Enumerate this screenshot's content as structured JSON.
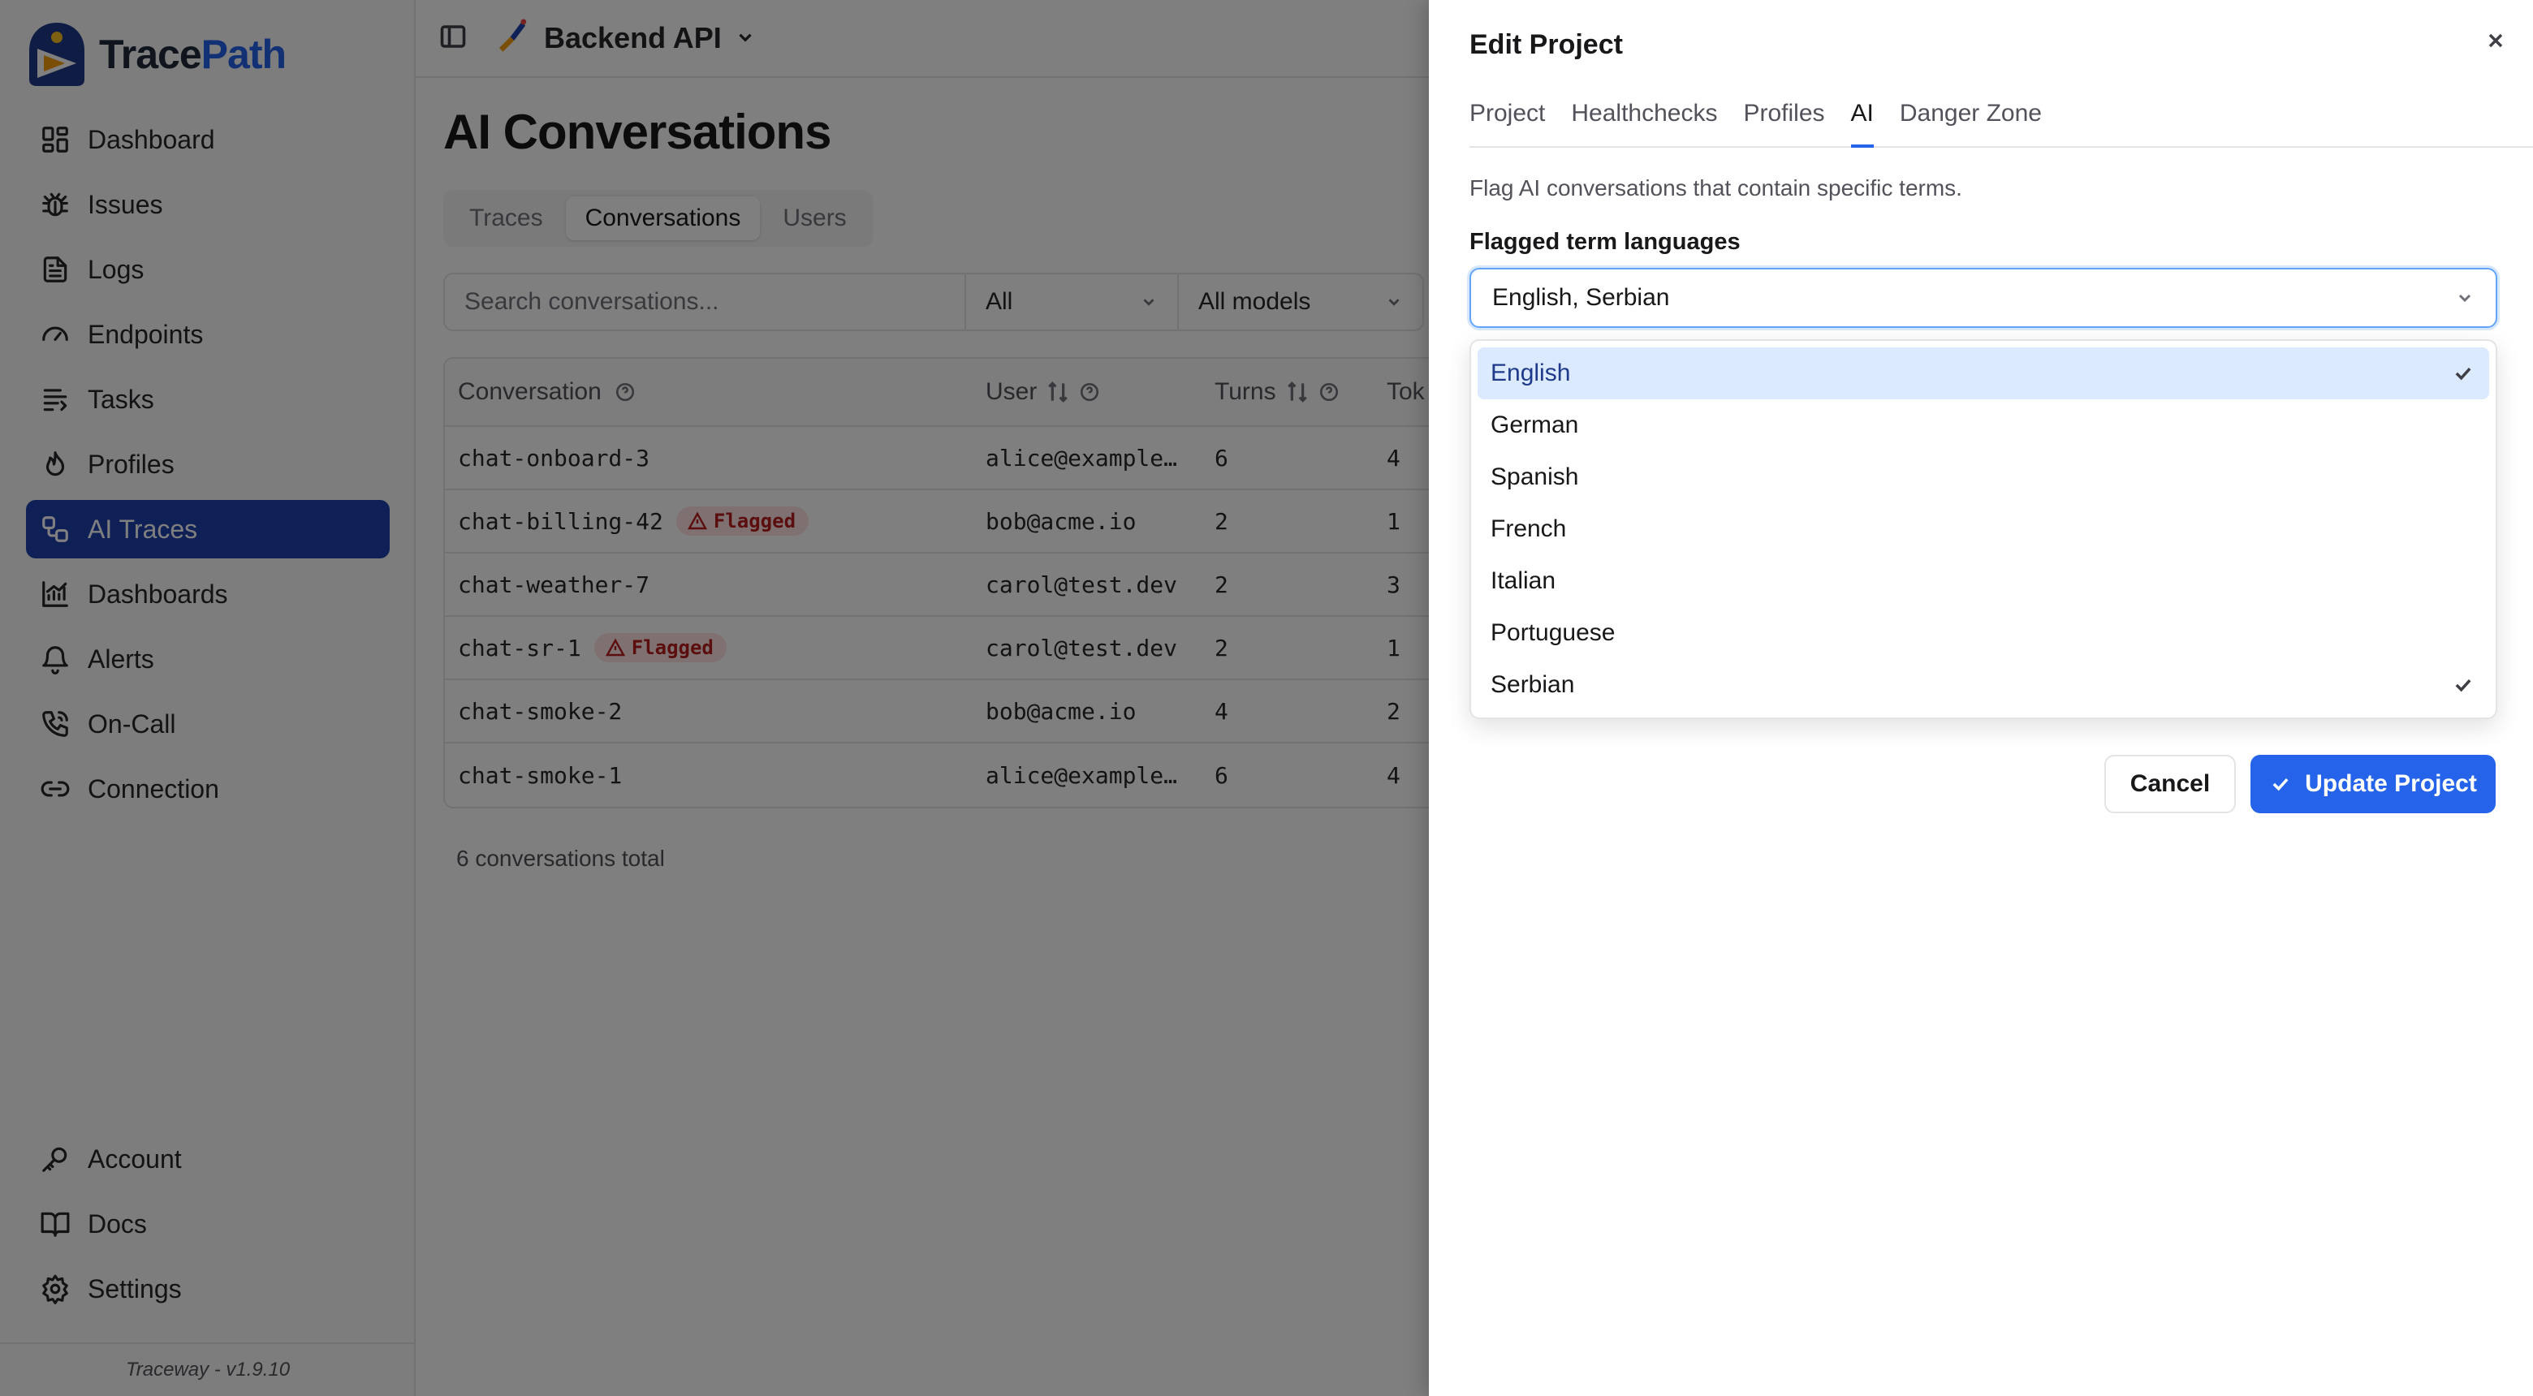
{
  "brand": {
    "name_a": "Trace",
    "name_b": "Path"
  },
  "sidebar": {
    "items": [
      {
        "label": "Dashboard",
        "icon": "dashboard-icon"
      },
      {
        "label": "Issues",
        "icon": "bug-icon"
      },
      {
        "label": "Logs",
        "icon": "file-text-icon"
      },
      {
        "label": "Endpoints",
        "icon": "gauge-icon"
      },
      {
        "label": "Tasks",
        "icon": "list-icon"
      },
      {
        "label": "Profiles",
        "icon": "flame-icon"
      },
      {
        "label": "AI Traces",
        "icon": "workflow-icon",
        "active": true
      },
      {
        "label": "Dashboards",
        "icon": "chart-icon"
      },
      {
        "label": "Alerts",
        "icon": "bell-icon"
      },
      {
        "label": "On-Call",
        "icon": "phone-icon"
      },
      {
        "label": "Connection",
        "icon": "link-icon"
      }
    ],
    "bottom_items": [
      {
        "label": "Account",
        "icon": "key-icon"
      },
      {
        "label": "Docs",
        "icon": "book-icon"
      },
      {
        "label": "Settings",
        "icon": "gear-icon"
      }
    ],
    "version": "Traceway - v1.9.10"
  },
  "header": {
    "project": "Backend API"
  },
  "page": {
    "title": "AI Conversations",
    "tabs": [
      "Traces",
      "Conversations",
      "Users"
    ],
    "active_tab": "Conversations",
    "search_placeholder": "Search conversations...",
    "filter_status": "All",
    "filter_models": "All models",
    "columns": {
      "conversation": "Conversation",
      "user": "User",
      "turns": "Turns",
      "tokens": "Tok"
    },
    "rows": [
      {
        "id": "chat-onboard-3",
        "flagged": false,
        "user": "alice@example…",
        "turns": "6",
        "tokens": "4"
      },
      {
        "id": "chat-billing-42",
        "flagged": true,
        "user": "bob@acme.io",
        "turns": "2",
        "tokens": "1"
      },
      {
        "id": "chat-weather-7",
        "flagged": false,
        "user": "carol@test.dev",
        "turns": "2",
        "tokens": "3"
      },
      {
        "id": "chat-sr-1",
        "flagged": true,
        "user": "carol@test.dev",
        "turns": "2",
        "tokens": "1"
      },
      {
        "id": "chat-smoke-2",
        "flagged": false,
        "user": "bob@acme.io",
        "turns": "4",
        "tokens": "2"
      },
      {
        "id": "chat-smoke-1",
        "flagged": false,
        "user": "alice@example…",
        "turns": "6",
        "tokens": "4"
      }
    ],
    "flag_label": "Flagged",
    "total": "6 conversations total"
  },
  "drawer": {
    "title": "Edit Project",
    "tabs": [
      "Project",
      "Healthchecks",
      "Profiles",
      "AI",
      "Danger Zone"
    ],
    "active_tab": "AI",
    "description": "Flag AI conversations that contain specific terms.",
    "field_label": "Flagged term languages",
    "selected_value": "English, Serbian",
    "options": [
      {
        "label": "English",
        "checked": true,
        "highlighted": true
      },
      {
        "label": "German",
        "checked": false
      },
      {
        "label": "Spanish",
        "checked": false
      },
      {
        "label": "French",
        "checked": false
      },
      {
        "label": "Italian",
        "checked": false
      },
      {
        "label": "Portuguese",
        "checked": false
      },
      {
        "label": "Serbian",
        "checked": true
      }
    ],
    "cancel_label": "Cancel",
    "update_label": "Update Project"
  },
  "colors": {
    "accent": "#2563eb",
    "active_nav": "#1e40af",
    "flag_bg": "#fee2e2",
    "flag_text": "#b91c1c"
  }
}
